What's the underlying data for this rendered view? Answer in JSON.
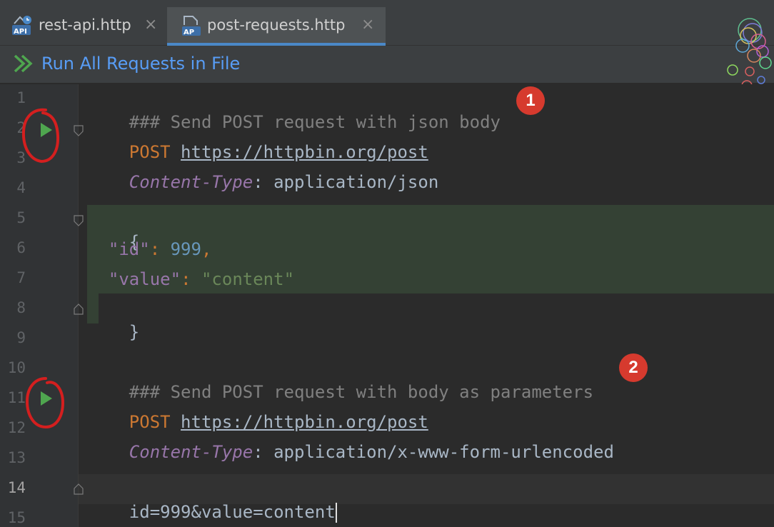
{
  "tabs": [
    {
      "label": "rest-api.http",
      "icon_text": "API",
      "active": false
    },
    {
      "label": "post-requests.http",
      "icon_text": "AP",
      "active": true
    }
  ],
  "toolbar": {
    "run_all_label": "Run All Requests in File"
  },
  "editor": {
    "line_numbers": [
      "1",
      "2",
      "3",
      "4",
      "5",
      "6",
      "7",
      "8",
      "9",
      "10",
      "11",
      "12",
      "13",
      "14",
      "15"
    ],
    "current_line": "14",
    "lines": {
      "l1": "### Send POST request with json body",
      "l2_method": "POST",
      "l2_url": "https://httpbin.org/post",
      "l3_header": "Content-Type",
      "l3_colon": ":",
      "l3_value": " application/json",
      "l5": "{",
      "l6_key": "\"id\"",
      "l6_colon": ": ",
      "l6_value": "999",
      "l6_comma": ",",
      "l7_key": "\"value\"",
      "l7_colon": ": ",
      "l7_value": "\"content\"",
      "l8": "}",
      "l10": "### Send POST request with body as parameters",
      "l11_method": "POST",
      "l11_url": "https://httpbin.org/post",
      "l12_header": "Content-Type",
      "l12_colon": ":",
      "l12_value": " application/x-www-form-urlencoded",
      "l14": "id=999&value=content"
    }
  },
  "annotations": {
    "badge1": "1",
    "badge2": "2"
  },
  "colors": {
    "accent": "#4a88c7",
    "link": "#589df6",
    "run_green": "#4fa64f",
    "annotation_red": "#d63a2e",
    "json_block_highlight": "#344134"
  }
}
